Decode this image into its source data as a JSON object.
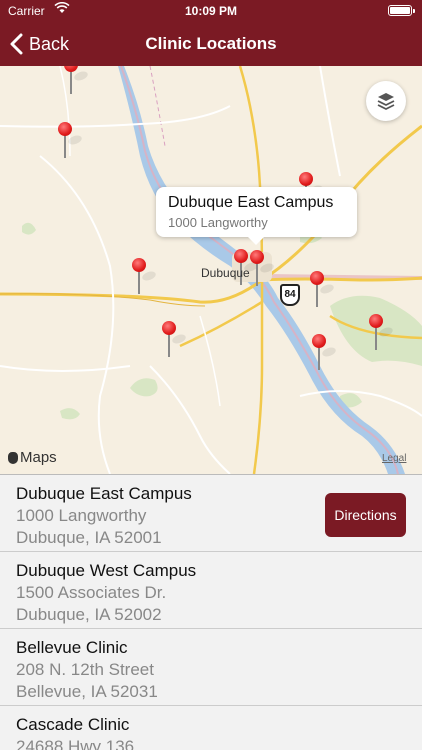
{
  "status_bar": {
    "carrier": "Carrier",
    "time": "10:09 PM"
  },
  "nav": {
    "back_label": "Back",
    "title": "Clinic Locations"
  },
  "map": {
    "city_label": "Dubuque",
    "road_shield": "84",
    "maps_logo_label": "Maps",
    "legal_label": "Legal",
    "callout": {
      "title": "Dubuque East Campus",
      "subtitle": "1000 Langworthy"
    }
  },
  "clinics": [
    {
      "name": "Dubuque East Campus",
      "address": "1000 Langworthy",
      "city_state": "Dubuque, IA 52001",
      "action": "Directions"
    },
    {
      "name": "Dubuque West Campus",
      "address": "1500 Associates Dr.",
      "city_state": "Dubuque, IA 52002"
    },
    {
      "name": "Bellevue Clinic",
      "address": "208 N. 12th Street",
      "city_state": "Bellevue, IA 52031"
    },
    {
      "name": "Cascade Clinic",
      "address": "24688 Hwy 136",
      "city_state": ""
    }
  ],
  "colors": {
    "brand": "#7b1a24",
    "pin": "#e01b1b"
  }
}
